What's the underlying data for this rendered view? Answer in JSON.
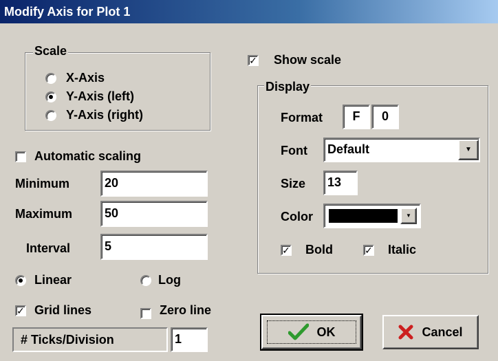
{
  "window": {
    "title": "Modify Axis for Plot 1"
  },
  "scale": {
    "legend": "Scale",
    "options": [
      "X-Axis",
      "Y-Axis (left)",
      "Y-Axis (right)"
    ],
    "selected": "Y-Axis (left)"
  },
  "automatic_scaling": {
    "label": "Automatic scaling",
    "checked": false
  },
  "minimum": {
    "label": "Minimum",
    "value": "20"
  },
  "maximum": {
    "label": "Maximum",
    "value": "50"
  },
  "interval": {
    "label": "Interval",
    "value": "5"
  },
  "scale_type": {
    "linear": "Linear",
    "log": "Log",
    "selected": "Linear"
  },
  "grid_lines": {
    "label": "Grid lines",
    "checked": true
  },
  "zero_line": {
    "label": "Zero line",
    "checked": false
  },
  "ticks": {
    "label": "# Ticks/Division",
    "value": "1"
  },
  "show_scale": {
    "label": "Show scale",
    "checked": true
  },
  "display": {
    "legend": "Display",
    "format_label": "Format",
    "format_type": "F",
    "format_digits": "0",
    "font_label": "Font",
    "font_value": "Default",
    "size_label": "Size",
    "size_value": "13",
    "color_label": "Color",
    "color_value": "#000000",
    "bold": {
      "label": "Bold",
      "checked": true
    },
    "italic": {
      "label": "Italic",
      "checked": true
    }
  },
  "buttons": {
    "ok": "OK",
    "cancel": "Cancel"
  },
  "icons": {
    "ok": "checkmark-icon",
    "cancel": "x-icon",
    "dropdown": "triangle-down-icon"
  }
}
